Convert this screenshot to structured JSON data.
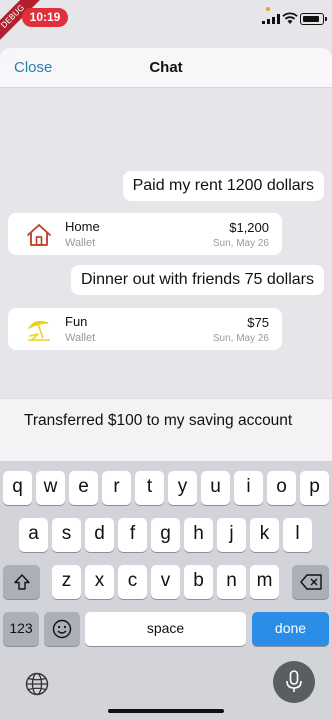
{
  "status_bar": {
    "ribbon_text": "DEBUG",
    "time": "10:19"
  },
  "header": {
    "close_label": "Close",
    "title": "Chat"
  },
  "chat": {
    "messages": [
      {
        "text": "Paid my rent 1200 dollars"
      },
      {
        "text": "Dinner out with friends 75 dollars"
      }
    ],
    "transactions": [
      {
        "category": "Home",
        "account": "Wallet",
        "amount": "$1,200",
        "date": "Sun, May 26",
        "icon": "house-icon",
        "icon_color": "#c0392b"
      },
      {
        "category": "Fun",
        "account": "Wallet",
        "amount": "$75",
        "date": "Sun, May 26",
        "icon": "beach-umbrella-icon",
        "icon_color": "#e8d320"
      }
    ]
  },
  "input": {
    "value": "Transferred $100 to my saving account"
  },
  "keyboard": {
    "row1": [
      "q",
      "w",
      "e",
      "r",
      "t",
      "y",
      "u",
      "i",
      "o",
      "p"
    ],
    "row2": [
      "a",
      "s",
      "d",
      "f",
      "g",
      "h",
      "j",
      "k",
      "l"
    ],
    "row3": [
      "z",
      "x",
      "c",
      "v",
      "b",
      "n",
      "m"
    ],
    "numbers_label": "123",
    "space_label": "space",
    "done_label": "done",
    "accent_color": "#2a8ee8"
  }
}
